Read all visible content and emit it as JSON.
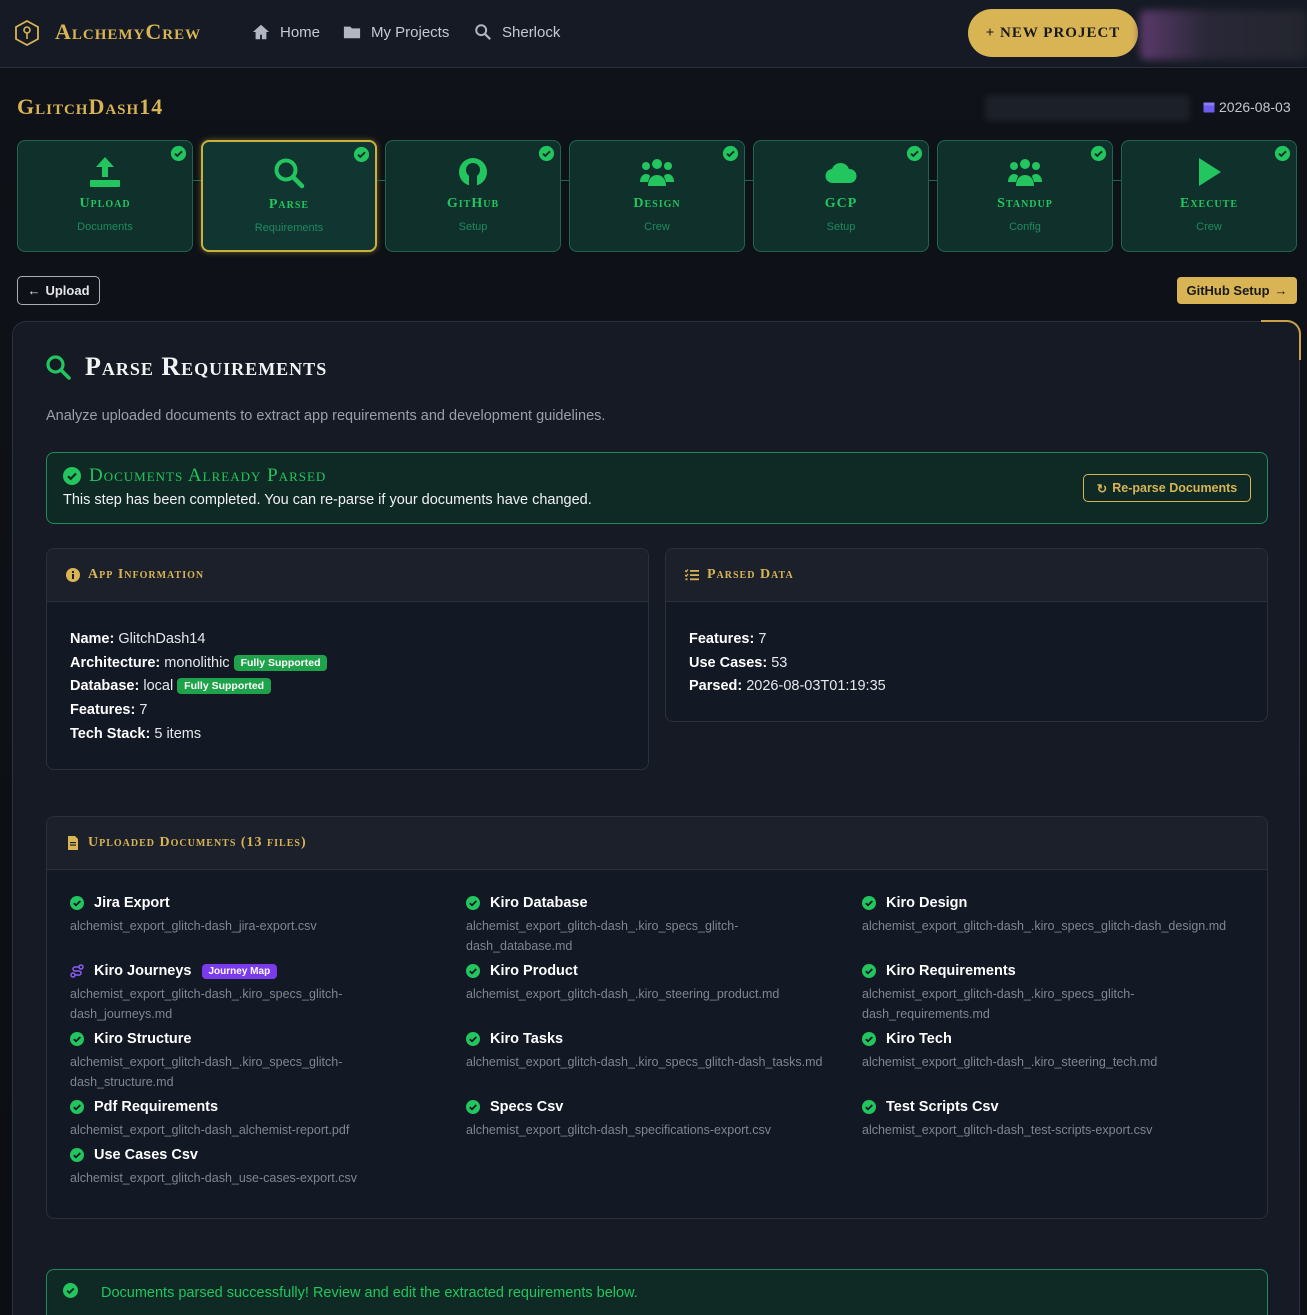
{
  "nav": {
    "brand": "AlchemyCrew",
    "links": [
      {
        "label": "Home",
        "icon": "home-icon"
      },
      {
        "label": "My Projects",
        "icon": "folder-icon"
      },
      {
        "label": "Sherlock",
        "icon": "search-icon"
      }
    ],
    "new_project_label": "+ NEW PROJECT"
  },
  "project": {
    "title": "GlitchDash14",
    "date": "2026-08-03"
  },
  "steps": [
    {
      "name": "Upload",
      "sub": "Documents",
      "icon": "upload-icon",
      "active": false
    },
    {
      "name": "Parse",
      "sub": "Requirements",
      "icon": "search-icon",
      "active": true
    },
    {
      "name": "GitHub",
      "sub": "Setup",
      "icon": "github-icon",
      "active": false
    },
    {
      "name": "Design",
      "sub": "Crew",
      "icon": "users-icon",
      "active": false
    },
    {
      "name": "GCP",
      "sub": "Setup",
      "icon": "cloud-icon",
      "active": false
    },
    {
      "name": "Standup",
      "sub": "Config",
      "icon": "users-icon",
      "active": false
    },
    {
      "name": "Execute",
      "sub": "Crew",
      "icon": "play-icon",
      "active": false
    }
  ],
  "buttons": {
    "back_label": "Upload",
    "next_label": "GitHub Setup",
    "reparse_label": "Re-parse Documents"
  },
  "main": {
    "title": "Parse Requirements",
    "intro": "Analyze uploaded documents to extract app requirements and development guidelines.",
    "done_title": "Documents Already Parsed",
    "done_desc": "This step has been completed. You can re-parse if your documents have changed."
  },
  "app_info": {
    "header": "App Information",
    "name_label": "Name:",
    "name": "GlitchDash14",
    "arch_label": "Architecture:",
    "arch": "monolithic",
    "arch_badge": "Fully Supported",
    "db_label": "Database:",
    "db": "local",
    "db_badge": "Fully Supported",
    "features_label": "Features:",
    "features": "7",
    "tech_label": "Tech Stack:",
    "tech": "5 items"
  },
  "parsed": {
    "header": "Parsed Data",
    "features_label": "Features:",
    "features": "7",
    "usecases_label": "Use Cases:",
    "usecases": "53",
    "parsed_label": "Parsed:",
    "parsed": "2026-08-03T01:19:35"
  },
  "documents": {
    "header": "Uploaded Documents (13 files)",
    "items": [
      {
        "name": "Jira Export",
        "file": "alchemist_export_glitch-dash_jira-export.csv"
      },
      {
        "name": "Kiro Database",
        "file": "alchemist_export_glitch-dash_.kiro_specs_glitch-dash_database.md"
      },
      {
        "name": "Kiro Design",
        "file": "alchemist_export_glitch-dash_.kiro_specs_glitch-dash_design.md"
      },
      {
        "name": "Kiro Journeys",
        "file": "alchemist_export_glitch-dash_.kiro_specs_glitch-dash_journeys.md",
        "badge": "Journey Map"
      },
      {
        "name": "Kiro Product",
        "file": "alchemist_export_glitch-dash_.kiro_steering_product.md"
      },
      {
        "name": "Kiro Requirements",
        "file": "alchemist_export_glitch-dash_.kiro_specs_glitch-dash_requirements.md"
      },
      {
        "name": "Kiro Structure",
        "file": "alchemist_export_glitch-dash_.kiro_specs_glitch-dash_structure.md"
      },
      {
        "name": "Kiro Tasks",
        "file": "alchemist_export_glitch-dash_.kiro_specs_glitch-dash_tasks.md"
      },
      {
        "name": "Kiro Tech",
        "file": "alchemist_export_glitch-dash_.kiro_steering_tech.md"
      },
      {
        "name": "Pdf Requirements",
        "file": "alchemist_export_glitch-dash_alchemist-report.pdf"
      },
      {
        "name": "Specs Csv",
        "file": "alchemist_export_glitch-dash_specifications-export.csv"
      },
      {
        "name": "Test Scripts Csv",
        "file": "alchemist_export_glitch-dash_test-scripts-export.csv"
      },
      {
        "name": "Use Cases Csv",
        "file": "alchemist_export_glitch-dash_use-cases-export.csv"
      }
    ]
  },
  "success_message": "Documents parsed successfully! Review and edit the extracted requirements below.",
  "colors": {
    "accent": "#d8b455",
    "success": "#22c55e",
    "journey": "#7c3aed",
    "background": "#0c0f14"
  }
}
